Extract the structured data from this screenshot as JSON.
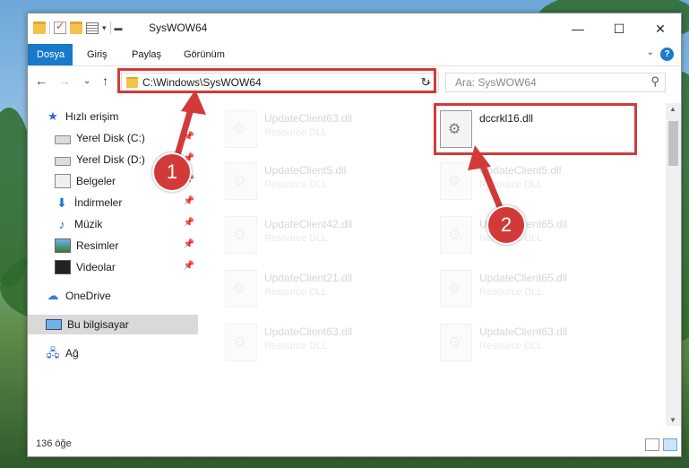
{
  "window": {
    "title": "SysWOW64"
  },
  "ribbon": {
    "tabs": [
      "Dosya",
      "Giriş",
      "Paylaş",
      "Görünüm"
    ],
    "help": "?"
  },
  "address": {
    "path": "C:\\Windows\\SysWOW64"
  },
  "search": {
    "placeholder": "Ara: SysWOW64"
  },
  "sidebar": {
    "items": [
      {
        "label": "Hızlı erişim"
      },
      {
        "label": "Yerel Disk (C:)"
      },
      {
        "label": "Yerel Disk (D:)"
      },
      {
        "label": "Belgeler"
      },
      {
        "label": "İndirmeler"
      },
      {
        "label": "Müzik"
      },
      {
        "label": "Resimler"
      },
      {
        "label": "Videolar"
      },
      {
        "label": "OneDrive"
      },
      {
        "label": "Bu bilgisayar"
      },
      {
        "label": "Ağ"
      }
    ]
  },
  "files": [
    {
      "name": "UpdateClient63.dll",
      "type": "Resource DLL"
    },
    {
      "name": "dccrkl16.dll",
      "type": ""
    },
    {
      "name": "UpdateClient5.dll",
      "type": "Resource DLL"
    },
    {
      "name": "UpdateClient5.dll",
      "type": "Resource DLL"
    },
    {
      "name": "UpdateClient42.dll",
      "type": "Resource DLL"
    },
    {
      "name": "UpdateClient65.dll",
      "type": "Resource DLL"
    },
    {
      "name": "UpdateClient21.dll",
      "type": "Resource DLL"
    },
    {
      "name": "UpdateClient65.dll",
      "type": "Resource DLL"
    },
    {
      "name": "UpdateClient63.dll",
      "type": "Resource DLL"
    },
    {
      "name": "UpdateClient63.dll",
      "type": "Resource DLL"
    }
  ],
  "status": {
    "count": "136 öğe"
  },
  "callouts": [
    "1",
    "2"
  ],
  "colors": {
    "accent": "#1979ca",
    "highlight": "#d23a3a"
  }
}
